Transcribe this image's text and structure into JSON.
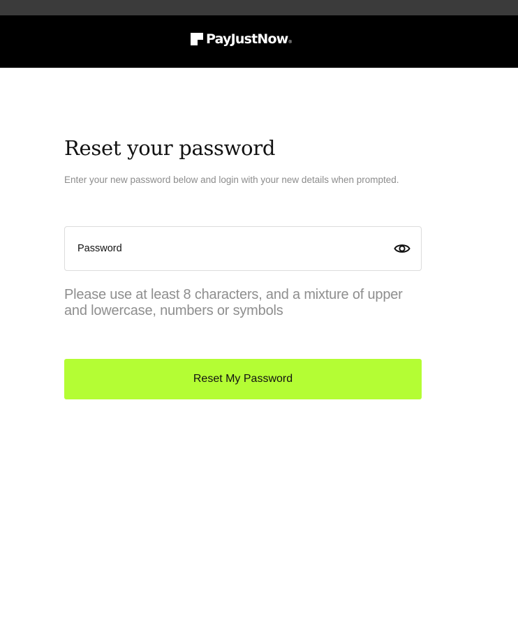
{
  "header": {
    "brand_name": "PayJustNow",
    "brand_mark": "®"
  },
  "main": {
    "title": "Reset your password",
    "subtitle": "Enter your new password below and login with your new details when prompted.",
    "password_field": {
      "placeholder": "Password",
      "value": "",
      "toggle_icon": "eye-icon"
    },
    "hint": "Please use at least 8 characters, and a mixture of upper and lowercase, numbers or symbols",
    "submit_label": "Reset My Password"
  },
  "colors": {
    "header_bg": "#000000",
    "accent": "#b4fd34",
    "muted_text": "#8c8c8c"
  }
}
